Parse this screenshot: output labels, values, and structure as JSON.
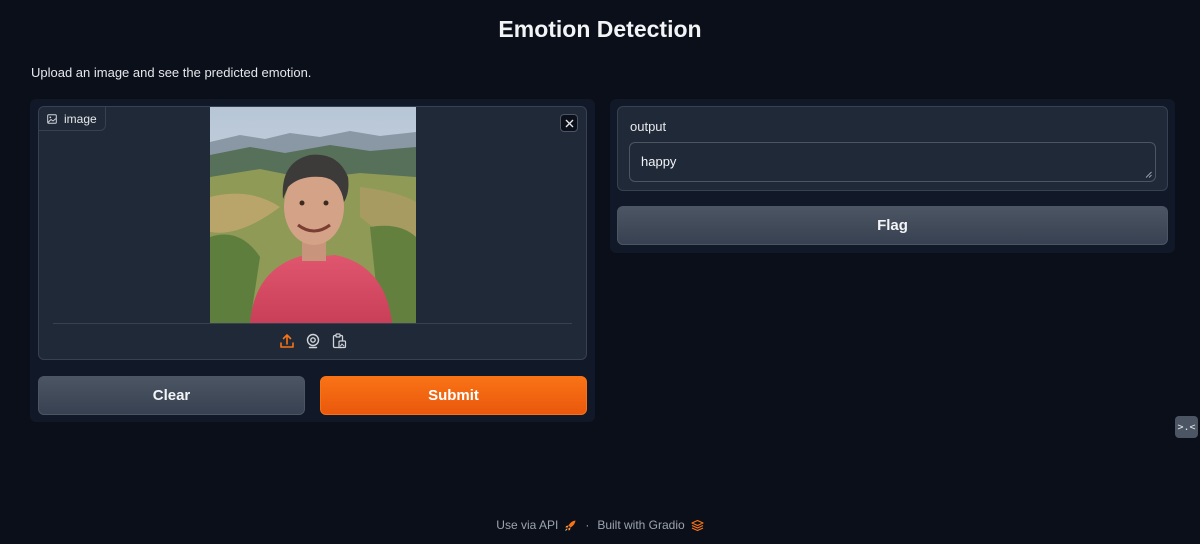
{
  "page": {
    "title": "Emotion Detection",
    "description": "Upload an image and see the predicted emotion."
  },
  "input": {
    "label": "image",
    "label_icon": "image-icon",
    "close_icon": "close-icon",
    "source_icons": [
      "upload-icon",
      "webcam-icon",
      "clipboard-icon"
    ]
  },
  "buttons": {
    "clear": "Clear",
    "submit": "Submit",
    "flag": "Flag"
  },
  "output": {
    "label": "output",
    "value": "happy"
  },
  "footer": {
    "api": "Use via API",
    "separator": "·",
    "built": "Built with Gradio"
  },
  "colors": {
    "background": "#0b0f19",
    "panel": "#111827",
    "block": "#1f2937",
    "accent": "#f97316"
  }
}
